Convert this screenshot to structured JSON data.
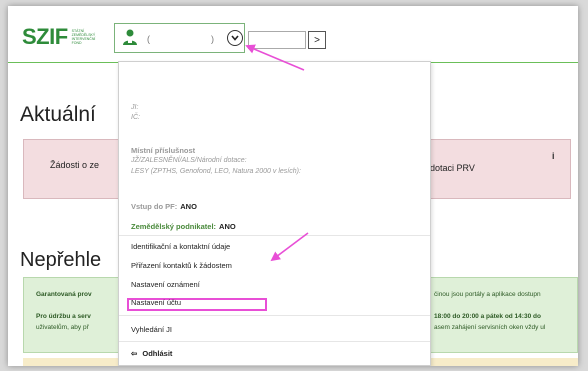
{
  "header": {
    "logo_text": "SZIF",
    "logo_subtext": "STÁTNÍ ZEMĚDĚLSKÝ INTERVENČNÍ FOND",
    "user_name": "(",
    "user_paren": ")",
    "search_button_label": ">",
    "chevron_icon": "chevron-down-icon",
    "user_icon": "user-icon"
  },
  "page": {
    "heading_aktualni": "Aktuální",
    "alert_left": "Žádosti o ze",
    "alert_right": "dotaci PRV",
    "alert_info_icon": "i",
    "heading_neprehl": "Nepřehle",
    "notice": {
      "line1_left": "Garantovaná prov",
      "line1_right": "činou jsou portály a aplikace dostupn",
      "line2_left": "Pro údržbu a serv",
      "line2_right": "18:00 do 20:00 a pátek od 14:30 do",
      "line3_left": "uživatelům, aby př",
      "line3_right": "asem zahájení servisních oken vždy ul"
    }
  },
  "menu": {
    "ji_label": "JI:",
    "ic_label": "IČ:",
    "mistni_label": "Místní příslušnost",
    "mistni_line1": "JŽ/ZALESNĚNÍ/ALS/Národní dotace:",
    "mistni_line2": "LESY (ZPTHS, Genofond, LEO, Natura 2000 v lesích):",
    "vstup_label": "Vstup do PF:",
    "vstup_value": "ANO",
    "zemed_label": "Zemědělský podnikatel:",
    "zemed_value": "ANO",
    "items": [
      "Identifikační a kontaktní údaje",
      "Přiřazení kontaktů k žádostem",
      "Nastavení oznámení",
      "Nastavení účtu"
    ],
    "search_ji": "Vyhledání JI",
    "logout_icon": "⇦",
    "logout": "Odhlásit"
  },
  "colors": {
    "brand_green": "#2e8b3a",
    "highlight": "#e84fd6",
    "alert_pink": "#f3dde0",
    "notice_green": "#dff0d8"
  }
}
